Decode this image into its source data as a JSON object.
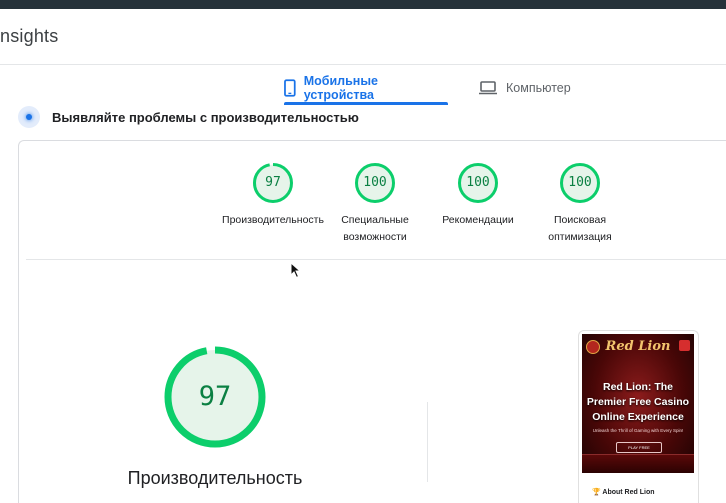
{
  "app": {
    "brand_fragment": "nsights"
  },
  "tabs": [
    {
      "label": "Мобильные устройства",
      "icon": "smartphone-icon",
      "active": true
    },
    {
      "label": "Компьютер",
      "icon": "laptop-icon",
      "active": false
    }
  ],
  "hint": {
    "text": "Выявляйте проблемы с производительностью"
  },
  "scores": [
    {
      "value": "97",
      "label_lines": [
        "Производительность"
      ]
    },
    {
      "value": "100",
      "label_lines": [
        "Специальные",
        "возможности"
      ]
    },
    {
      "value": "100",
      "label_lines": [
        "Рекомендации"
      ]
    },
    {
      "value": "100",
      "label_lines": [
        "Поисковая",
        "оптимизация"
      ]
    }
  ],
  "main_score": {
    "value": "97",
    "label": "Производительность"
  },
  "preview": {
    "brand": "Red Lion",
    "headline": "Red Lion: The Premier Free Casino Online Experience",
    "subtext": "Unleash the Thrill of Gaming with Every Spin!",
    "button": "PLAY FREE",
    "caption": "🏆 About Red Lion"
  },
  "colors": {
    "accent": "#1a73e8",
    "pass_green": "#0cce6b",
    "pass_fill": "#e6f4ea",
    "pass_text": "#0b8043"
  }
}
